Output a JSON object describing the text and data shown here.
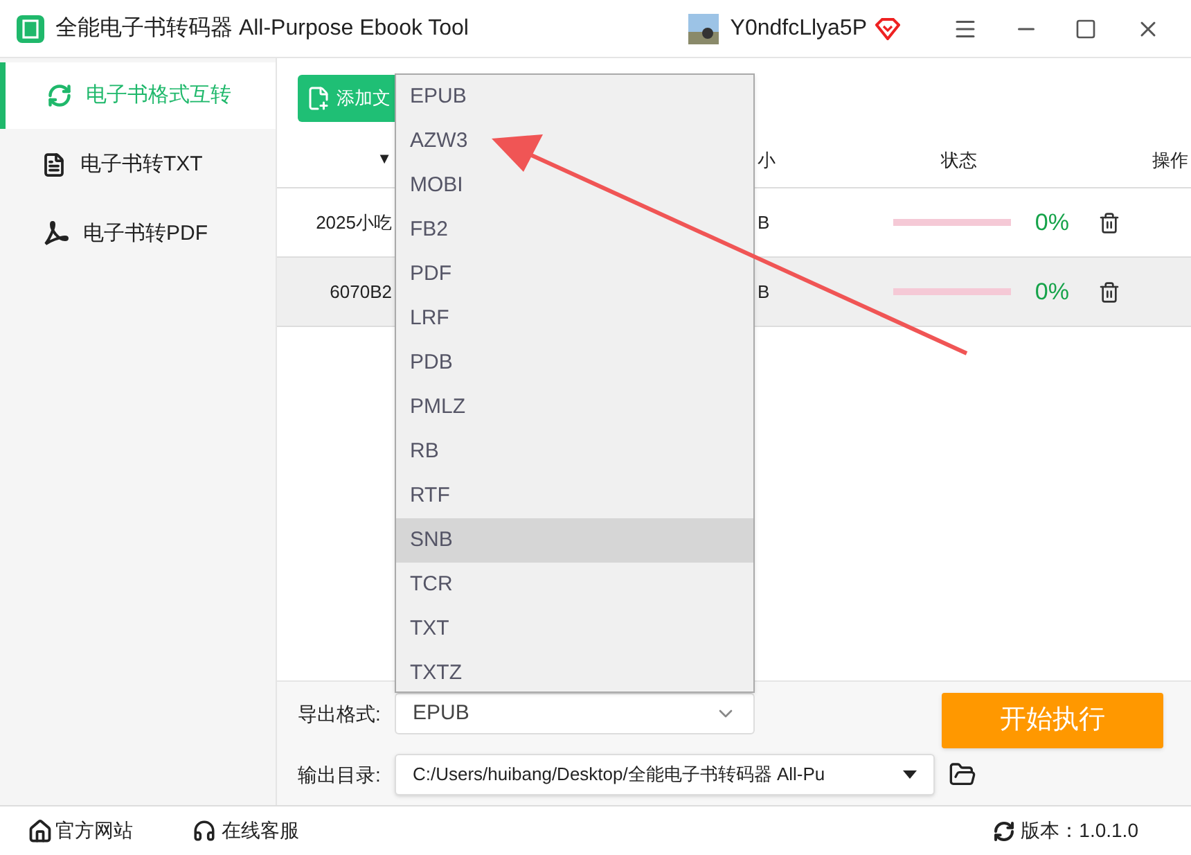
{
  "window": {
    "title": "全能电子书转码器 All-Purpose Ebook Tool",
    "user": "Y0ndfcLlya5P"
  },
  "sidebar": {
    "items": [
      {
        "label": "电子书格式互转",
        "selected": true,
        "kind": "convert"
      },
      {
        "label": "电子书转TXT",
        "selected": false,
        "kind": "txt"
      },
      {
        "label": "电子书转PDF",
        "selected": false,
        "kind": "pdf"
      }
    ]
  },
  "toolbar": {
    "add_button": "添加文"
  },
  "table": {
    "columns": [
      "▼",
      "小",
      "状态",
      "操作"
    ],
    "rows": [
      {
        "name": "2025小吃",
        "size": "B",
        "level": 0,
        "percent": "0%",
        "selected": false
      },
      {
        "name": "6070B2",
        "size": "B",
        "level": 0,
        "percent": "0%",
        "selected": true
      }
    ]
  },
  "format_dropdown": {
    "options": [
      {
        "label": "EPUB",
        "highlighted": false
      },
      {
        "label": "AZW3",
        "highlighted": false
      },
      {
        "label": "MOBI",
        "highlighted": false
      },
      {
        "label": "FB2",
        "highlighted": false
      },
      {
        "label": "PDF",
        "highlighted": false
      },
      {
        "label": "LRF",
        "highlighted": false
      },
      {
        "label": "PDB",
        "highlighted": false
      },
      {
        "label": "PMLZ",
        "highlighted": false
      },
      {
        "label": "RB",
        "highlighted": false
      },
      {
        "label": "RTF",
        "highlighted": false
      },
      {
        "label": "SNB",
        "highlighted": true
      },
      {
        "label": "TCR",
        "highlighted": false
      },
      {
        "label": "TXT",
        "highlighted": false
      },
      {
        "label": "TXTZ",
        "highlighted": false
      }
    ]
  },
  "export_format": {
    "label": "导出格式:",
    "value": "EPUB"
  },
  "output_dir": {
    "label": "输出目录:",
    "value": "C:/Users/huibang/Desktop/全能电子书转码器 All-Pu"
  },
  "start_button": "开始执行",
  "status_bar": {
    "website": "官方网站",
    "support": "在线客服",
    "version": "版本：1.0.1.0"
  }
}
